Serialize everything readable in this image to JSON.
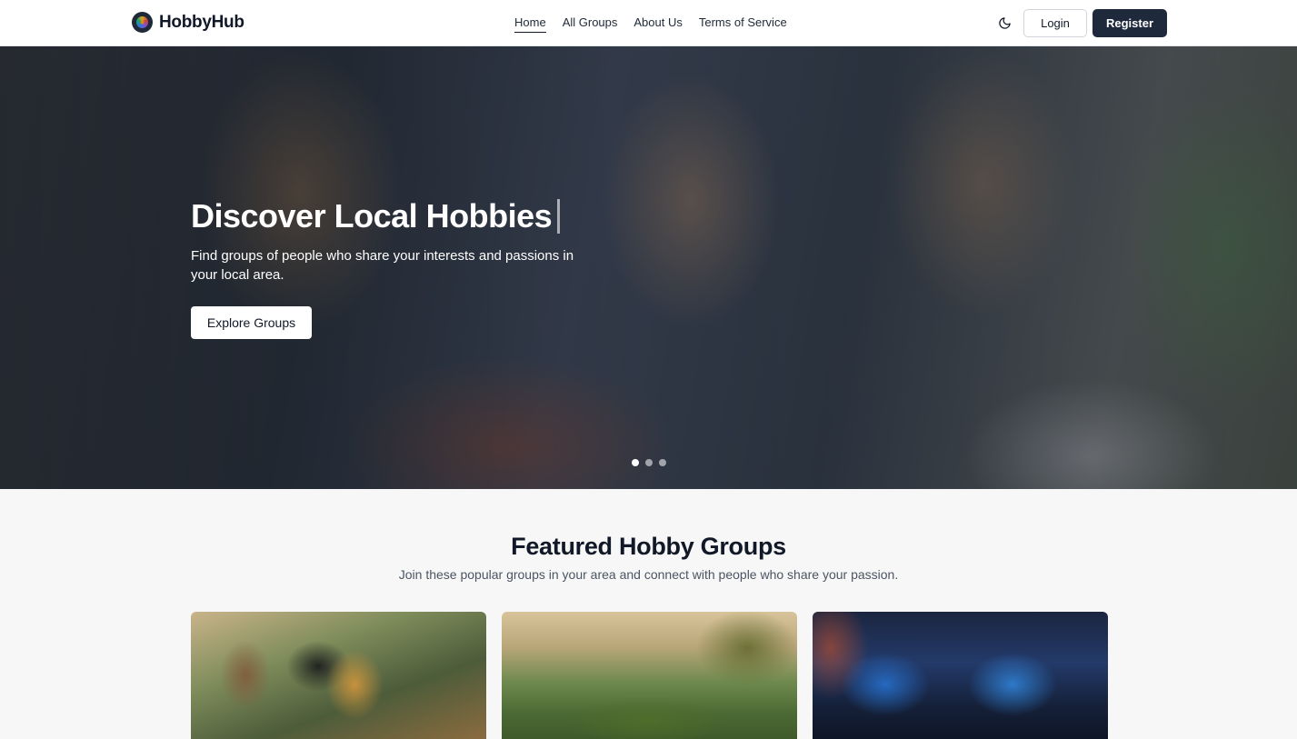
{
  "header": {
    "brand": "HobbyHub",
    "nav": [
      {
        "label": "Home",
        "active": true
      },
      {
        "label": "All Groups",
        "active": false
      },
      {
        "label": "About Us",
        "active": false
      },
      {
        "label": "Terms of Service",
        "active": false
      }
    ],
    "theme_icon": "moon-icon",
    "login_label": "Login",
    "register_label": "Register"
  },
  "hero": {
    "title": "Discover Local Hobbies",
    "subtitle": "Find groups of people who share your interests and passions in your local area.",
    "cta_label": "Explore Groups",
    "slides_count": 3,
    "active_slide": 1
  },
  "featured": {
    "title": "Featured Hobby Groups",
    "subtitle": "Join these popular groups in your area and connect with people who share your passion."
  },
  "colors": {
    "primary": "#1e293b",
    "background": "#f7f7f7",
    "header_bg": "#ffffff"
  }
}
